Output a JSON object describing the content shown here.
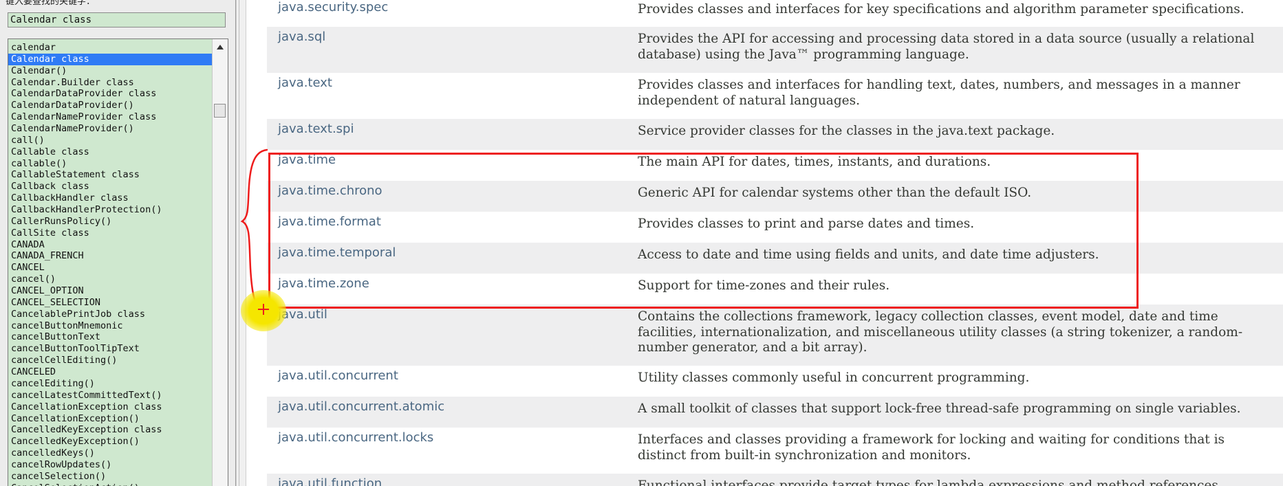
{
  "left_pane": {
    "top_label": "键入要查找的关键字：",
    "search_value": "Calendar class",
    "index_items": [
      "calendar",
      "Calendar class",
      "Calendar()",
      "Calendar.Builder class",
      "CalendarDataProvider class",
      "CalendarDataProvider()",
      "CalendarNameProvider class",
      "CalendarNameProvider()",
      "call()",
      "Callable class",
      "callable()",
      "CallableStatement class",
      "Callback class",
      "CallbackHandler class",
      "CallbackHandlerProtection()",
      "CallerRunsPolicy()",
      "CallSite class",
      "CANADA",
      "CANADA_FRENCH",
      "CANCEL",
      "cancel()",
      "CANCEL_OPTION",
      "CANCEL_SELECTION",
      "CancelablePrintJob class",
      "cancelButtonMnemonic",
      "cancelButtonText",
      "cancelButtonToolTipText",
      "cancelCellEditing()",
      "CANCELED",
      "cancelEditing()",
      "cancelLatestCommittedText()",
      "CancellationException class",
      "CancellationException()",
      "CancelledKeyException class",
      "CancelledKeyException()",
      "cancelledKeys()",
      "cancelRowUpdates()",
      "cancelSelection()",
      "CancelSelectionAction()"
    ],
    "selected_index": 1
  },
  "packages": [
    {
      "name": "java.security.spec",
      "desc": "Provides classes and interfaces for key specifications and algorithm parameter specifications."
    },
    {
      "name": "java.sql",
      "desc": "Provides the API for accessing and processing data stored in a data source (usually a relational database) using the Java™ programming language."
    },
    {
      "name": "java.text",
      "desc": "Provides classes and interfaces for handling text, dates, numbers, and messages in a manner independent of natural languages."
    },
    {
      "name": "java.text.spi",
      "desc": "Service provider classes for the classes in the java.text package."
    },
    {
      "name": "java.time",
      "desc": "The main API for dates, times, instants, and durations."
    },
    {
      "name": "java.time.chrono",
      "desc": "Generic API for calendar systems other than the default ISO."
    },
    {
      "name": "java.time.format",
      "desc": "Provides classes to print and parse dates and times."
    },
    {
      "name": "java.time.temporal",
      "desc": "Access to date and time using fields and units, and date time adjusters."
    },
    {
      "name": "java.time.zone",
      "desc": "Support for time-zones and their rules."
    },
    {
      "name": "java.util",
      "desc": "Contains the collections framework, legacy collection classes, event model, date and time facilities, internationalization, and miscellaneous utility classes (a string tokenizer, a random-number generator, and a bit array)."
    },
    {
      "name": "java.util.concurrent",
      "desc": "Utility classes commonly useful in concurrent programming."
    },
    {
      "name": "java.util.concurrent.atomic",
      "desc": "A small toolkit of classes that support lock-free thread-safe programming on single variables."
    },
    {
      "name": "java.util.concurrent.locks",
      "desc": "Interfaces and classes providing a framework for locking and waiting for conditions that is distinct from built-in synchronization and monitors."
    },
    {
      "name": "java.util.function",
      "desc": "Functional interfaces provide target types for lambda expressions and method references."
    }
  ],
  "colors": {
    "index_background": "#cfe8cf",
    "selection": "#2f7bf5",
    "link": "#4a6782",
    "row_alt": "#eeeeef",
    "annotation": "#ee1c1c",
    "cursor_highlight": "#f5e600"
  }
}
